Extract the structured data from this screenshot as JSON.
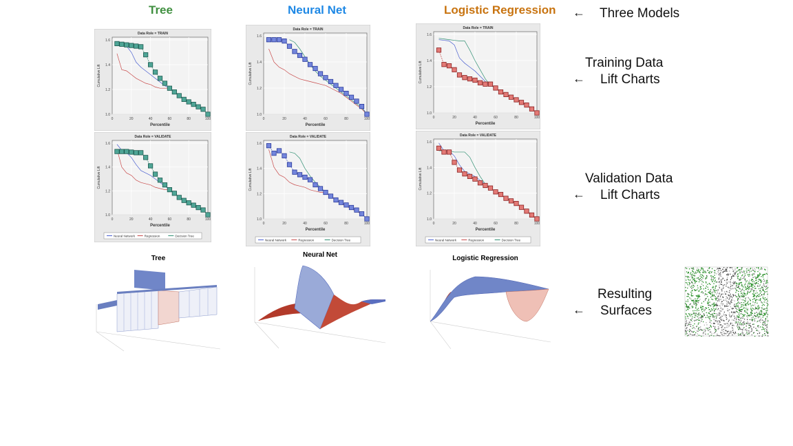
{
  "models": {
    "tree": {
      "title": "Tree",
      "color": "#3f8f3f"
    },
    "neural": {
      "title": "Neural Net",
      "color": "#1e88e5"
    },
    "logistic": {
      "title": "Logistic Regression",
      "color": "#c8730f"
    }
  },
  "labels": {
    "three_models": "Three Models",
    "training_1": "Training Data",
    "training_2": "Lift Charts",
    "validation_1": "Validation Data",
    "validation_2": "Lift Charts",
    "surfaces_1": "Resulting",
    "surfaces_2": "Surfaces",
    "arrow": "←"
  },
  "surfaces": {
    "tree": "Tree",
    "neural": "Neural Net",
    "logistic": "Logistic Regression"
  },
  "legend": {
    "neural": "Neural Network",
    "regression": "Regression",
    "tree": "Decision Tree"
  },
  "series_colors": {
    "neural": "#4a5fd0",
    "regression": "#c84a4a",
    "tree": "#2f8f72"
  },
  "chart_data": [
    {
      "type": "line",
      "title": "Data Role = TRAIN",
      "xlabel": "Percentile",
      "ylabel": "Cumulative Lift",
      "xlim": [
        0,
        100
      ],
      "ylim": [
        1.0,
        1.6
      ],
      "xticks": [
        0,
        20,
        40,
        60,
        80,
        100
      ],
      "yticks": [
        1.0,
        1.2,
        1.4,
        1.6
      ],
      "highlight": "tree",
      "grid": true,
      "x": [
        5,
        10,
        15,
        20,
        25,
        30,
        35,
        40,
        45,
        50,
        55,
        60,
        65,
        70,
        75,
        80,
        85,
        90,
        95,
        100
      ],
      "series": {
        "tree": [
          1.57,
          1.565,
          1.56,
          1.555,
          1.55,
          1.545,
          1.48,
          1.4,
          1.34,
          1.29,
          1.25,
          1.21,
          1.18,
          1.15,
          1.12,
          1.1,
          1.08,
          1.06,
          1.04,
          1.0
        ],
        "neural": [
          1.56,
          1.56,
          1.55,
          1.5,
          1.42,
          1.38,
          1.35,
          1.32,
          1.29,
          1.26,
          1.23,
          1.21,
          1.18,
          1.15,
          1.12,
          1.1,
          1.08,
          1.06,
          1.04,
          1.0
        ],
        "regression": [
          1.49,
          1.36,
          1.35,
          1.32,
          1.29,
          1.27,
          1.25,
          1.24,
          1.22,
          1.21,
          1.21,
          1.21,
          1.18,
          1.15,
          1.12,
          1.1,
          1.08,
          1.06,
          1.04,
          1.0
        ]
      }
    },
    {
      "type": "line",
      "title": "Data Role = VALIDATE",
      "xlabel": "Percentile",
      "ylabel": "Cumulative Lift",
      "xlim": [
        0,
        100
      ],
      "ylim": [
        1.0,
        1.6
      ],
      "xticks": [
        0,
        20,
        40,
        60,
        80,
        100
      ],
      "yticks": [
        1.0,
        1.2,
        1.4,
        1.6
      ],
      "highlight": "tree",
      "grid": true,
      "legend": true,
      "x": [
        5,
        10,
        15,
        20,
        25,
        30,
        35,
        40,
        45,
        50,
        55,
        60,
        65,
        70,
        75,
        80,
        85,
        90,
        95,
        100
      ],
      "series": {
        "tree": [
          1.53,
          1.53,
          1.53,
          1.525,
          1.52,
          1.52,
          1.48,
          1.41,
          1.34,
          1.29,
          1.25,
          1.21,
          1.18,
          1.145,
          1.12,
          1.1,
          1.08,
          1.06,
          1.04,
          1.0
        ],
        "neural": [
          1.59,
          1.54,
          1.52,
          1.48,
          1.42,
          1.37,
          1.35,
          1.33,
          1.3,
          1.27,
          1.24,
          1.21,
          1.18,
          1.15,
          1.12,
          1.1,
          1.08,
          1.06,
          1.04,
          1.0
        ],
        "regression": [
          1.55,
          1.4,
          1.35,
          1.33,
          1.29,
          1.27,
          1.26,
          1.25,
          1.23,
          1.22,
          1.21,
          1.21,
          1.18,
          1.15,
          1.12,
          1.1,
          1.08,
          1.06,
          1.04,
          1.0
        ]
      }
    },
    {
      "type": "line",
      "title": "Data Role = TRAIN",
      "xlabel": "Percentile",
      "ylabel": "Cumulative Lift",
      "xlim": [
        0,
        100
      ],
      "ylim": [
        1.0,
        1.6
      ],
      "xticks": [
        0,
        20,
        40,
        60,
        80,
        100
      ],
      "yticks": [
        1.0,
        1.2,
        1.4,
        1.6
      ],
      "highlight": "neural",
      "grid": true,
      "x": [
        5,
        10,
        15,
        20,
        25,
        30,
        35,
        40,
        45,
        50,
        55,
        60,
        65,
        70,
        75,
        80,
        85,
        90,
        95,
        100
      ],
      "series": {
        "neural": [
          1.57,
          1.57,
          1.57,
          1.56,
          1.52,
          1.48,
          1.45,
          1.42,
          1.38,
          1.35,
          1.31,
          1.28,
          1.25,
          1.22,
          1.19,
          1.16,
          1.13,
          1.1,
          1.06,
          1.0
        ],
        "tree": [
          null,
          null,
          null,
          null,
          1.57,
          1.55,
          1.5,
          1.44,
          1.38,
          1.33,
          1.29,
          1.26,
          1.23,
          1.2,
          1.17,
          1.14,
          1.11,
          1.08,
          1.05,
          1.0
        ],
        "regression": [
          1.5,
          1.4,
          1.36,
          1.34,
          1.31,
          1.29,
          1.27,
          1.26,
          1.25,
          1.24,
          1.23,
          1.22,
          1.2,
          1.18,
          1.16,
          1.13,
          1.1,
          1.07,
          1.04,
          1.0
        ]
      }
    },
    {
      "type": "line",
      "title": "Data Role = VALIDATE",
      "xlabel": "Percentile",
      "ylabel": "Cumulative Lift",
      "xlim": [
        0,
        100
      ],
      "ylim": [
        1.0,
        1.6
      ],
      "xticks": [
        0,
        20,
        40,
        60,
        80,
        100
      ],
      "yticks": [
        1.0,
        1.2,
        1.4,
        1.6
      ],
      "highlight": "neural",
      "grid": true,
      "legend": true,
      "x": [
        5,
        10,
        15,
        20,
        25,
        30,
        35,
        40,
        45,
        50,
        55,
        60,
        65,
        70,
        75,
        80,
        85,
        90,
        95,
        100
      ],
      "series": {
        "neural": [
          1.58,
          1.52,
          1.54,
          1.5,
          1.43,
          1.37,
          1.35,
          1.33,
          1.31,
          1.27,
          1.24,
          1.21,
          1.18,
          1.15,
          1.13,
          1.11,
          1.09,
          1.07,
          1.04,
          1.0
        ],
        "tree": [
          null,
          null,
          null,
          null,
          1.53,
          1.52,
          1.48,
          1.4,
          1.34,
          1.29,
          1.25,
          1.21,
          1.18,
          1.15,
          1.12,
          1.1,
          1.08,
          1.06,
          1.04,
          1.0
        ],
        "regression": [
          1.55,
          1.41,
          1.35,
          1.33,
          1.29,
          1.27,
          1.26,
          1.25,
          1.23,
          1.22,
          1.21,
          1.21,
          1.18,
          1.15,
          1.12,
          1.1,
          1.08,
          1.06,
          1.04,
          1.0
        ]
      }
    },
    {
      "type": "line",
      "title": "Data Role = TRAIN",
      "xlabel": "Percentile",
      "ylabel": "Cumulative Lift",
      "xlim": [
        0,
        100
      ],
      "ylim": [
        1.0,
        1.6
      ],
      "xticks": [
        0,
        20,
        40,
        60,
        80,
        100
      ],
      "yticks": [
        1.0,
        1.2,
        1.4,
        1.6
      ],
      "highlight": "regression",
      "grid": true,
      "x": [
        5,
        10,
        15,
        20,
        25,
        30,
        35,
        40,
        45,
        50,
        55,
        60,
        65,
        70,
        75,
        80,
        85,
        90,
        95,
        100
      ],
      "series": {
        "regression": [
          1.48,
          1.37,
          1.36,
          1.33,
          1.29,
          1.27,
          1.26,
          1.25,
          1.23,
          1.22,
          1.22,
          1.19,
          1.16,
          1.14,
          1.12,
          1.1,
          1.08,
          1.06,
          1.03,
          1.0
        ],
        "neural": [
          1.56,
          1.555,
          1.55,
          1.52,
          1.42,
          1.38,
          1.35,
          1.32,
          1.28,
          1.24,
          1.21,
          1.19,
          1.16,
          1.14,
          1.12,
          1.1,
          1.08,
          1.06,
          1.03,
          1.0
        ],
        "tree": [
          1.57,
          1.565,
          1.56,
          1.555,
          1.55,
          1.55,
          1.48,
          1.4,
          1.33,
          1.26,
          1.21,
          1.19,
          1.16,
          1.14,
          1.12,
          1.1,
          1.08,
          1.06,
          1.03,
          1.0
        ]
      }
    },
    {
      "type": "line",
      "title": "Data Role = VALIDATE",
      "xlabel": "Percentile",
      "ylabel": "Cumulative Lift",
      "xlim": [
        0,
        100
      ],
      "ylim": [
        1.0,
        1.6
      ],
      "xticks": [
        0,
        20,
        40,
        60,
        80,
        100
      ],
      "yticks": [
        1.0,
        1.2,
        1.4,
        1.6
      ],
      "highlight": "regression",
      "grid": true,
      "legend": true,
      "x": [
        5,
        10,
        15,
        20,
        25,
        30,
        35,
        40,
        45,
        50,
        55,
        60,
        65,
        70,
        75,
        80,
        85,
        90,
        95,
        100
      ],
      "series": {
        "regression": [
          1.55,
          1.52,
          1.52,
          1.44,
          1.38,
          1.35,
          1.33,
          1.31,
          1.28,
          1.26,
          1.24,
          1.21,
          1.19,
          1.16,
          1.14,
          1.12,
          1.09,
          1.06,
          1.03,
          1.0
        ],
        "neural": [
          1.59,
          1.53,
          1.53,
          1.49,
          1.42,
          1.37,
          1.35,
          1.33,
          1.3,
          1.27,
          1.24,
          1.21,
          1.19,
          1.16,
          1.14,
          1.12,
          1.09,
          1.06,
          1.03,
          1.0
        ],
        "tree": [
          1.53,
          1.53,
          1.53,
          1.52,
          1.52,
          1.52,
          1.48,
          1.4,
          1.33,
          1.27,
          1.24,
          1.21,
          1.19,
          1.16,
          1.14,
          1.12,
          1.09,
          1.06,
          1.03,
          1.0
        ]
      }
    }
  ]
}
